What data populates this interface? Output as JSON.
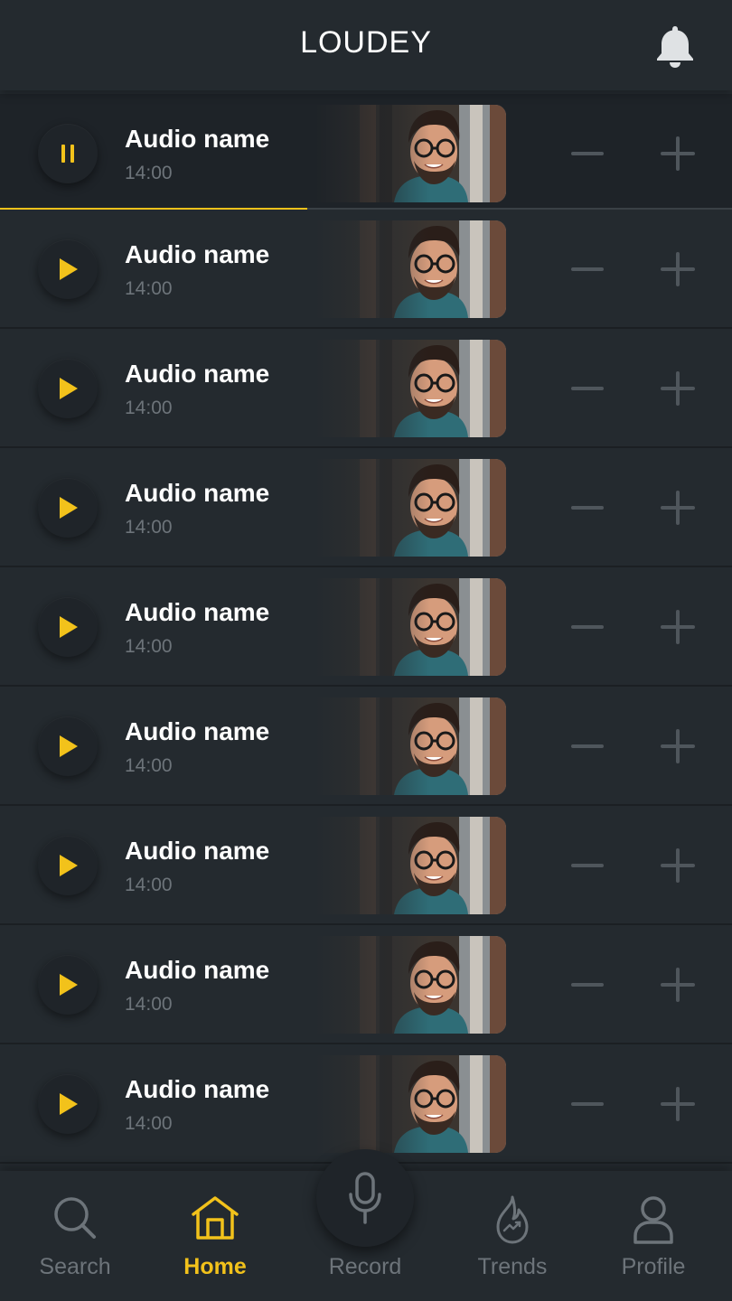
{
  "app": {
    "title": "LOUDEY"
  },
  "colors": {
    "accent": "#f2c21b",
    "background": "#242a2f",
    "muted": "#6d747a",
    "text": "#ffffff"
  },
  "header": {
    "title": "LOUDEY",
    "notification_icon": "bell-icon"
  },
  "playlist": {
    "items": [
      {
        "title": "Audio name",
        "duration": "14:00",
        "state": "playing",
        "progress": 0.42
      },
      {
        "title": "Audio name",
        "duration": "14:00",
        "state": "paused"
      },
      {
        "title": "Audio name",
        "duration": "14:00",
        "state": "paused"
      },
      {
        "title": "Audio name",
        "duration": "14:00",
        "state": "paused"
      },
      {
        "title": "Audio name",
        "duration": "14:00",
        "state": "paused"
      },
      {
        "title": "Audio name",
        "duration": "14:00",
        "state": "paused"
      },
      {
        "title": "Audio name",
        "duration": "14:00",
        "state": "paused"
      },
      {
        "title": "Audio name",
        "duration": "14:00",
        "state": "paused"
      },
      {
        "title": "Audio name",
        "duration": "14:00",
        "state": "paused"
      }
    ]
  },
  "bottom_nav": {
    "items": [
      {
        "label": "Search",
        "icon": "search-icon",
        "active": false
      },
      {
        "label": "Home",
        "icon": "home-icon",
        "active": true
      },
      {
        "label": "Record",
        "icon": "microphone-icon",
        "active": false
      },
      {
        "label": "Trends",
        "icon": "flame-trend-icon",
        "active": false
      },
      {
        "label": "Profile",
        "icon": "user-icon",
        "active": false
      }
    ]
  }
}
